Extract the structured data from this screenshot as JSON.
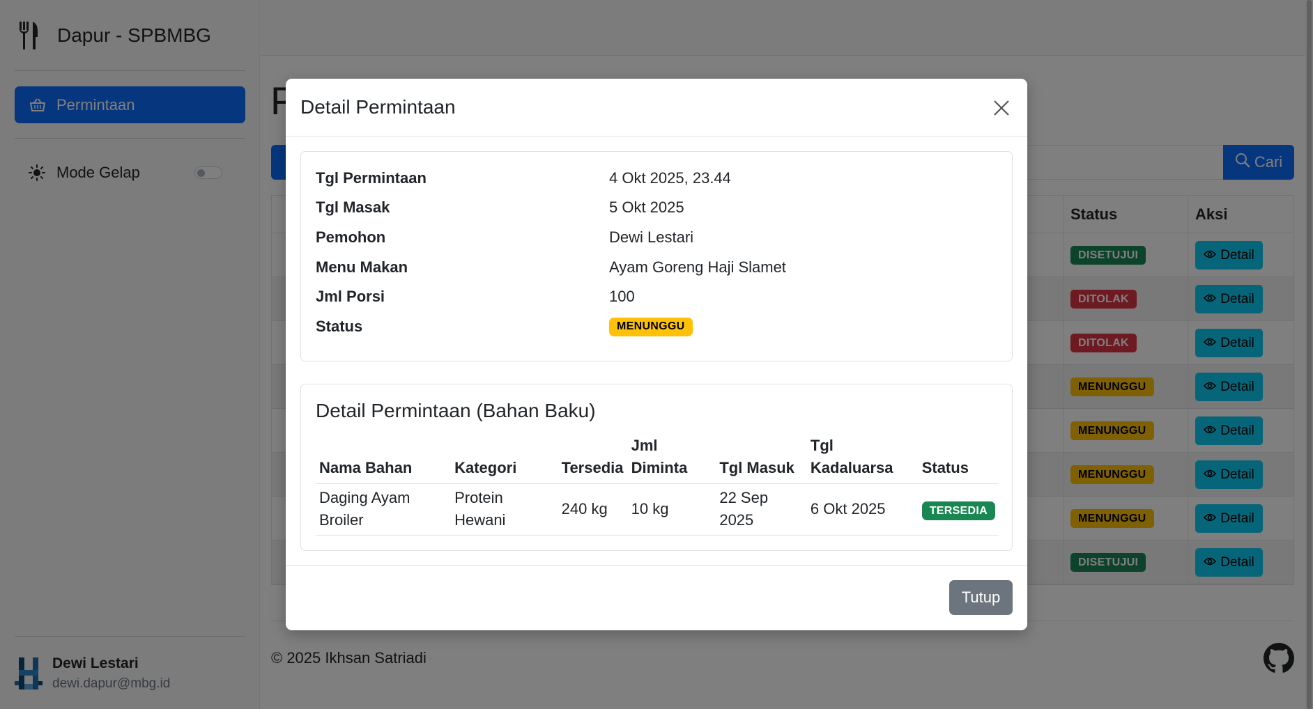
{
  "sidebar": {
    "brand": "Dapur - SPBMBG",
    "nav": [
      {
        "label": "Permintaan",
        "icon": "basket-icon"
      }
    ],
    "dark_mode_label": "Mode Gelap",
    "user": {
      "name": "Dewi Lestari",
      "email": "dewi.dapur@mbg.id"
    }
  },
  "page": {
    "title_peek": "P",
    "search_button": "Cari",
    "table_headers": {
      "status": "Status",
      "aksi": "Aksi"
    },
    "rows": [
      {
        "status": "DISETUJUI",
        "status_color": "#198754",
        "action": "Detail"
      },
      {
        "status": "DITOLAK",
        "status_color": "#dc3545",
        "action": "Detail"
      },
      {
        "status": "DITOLAK",
        "status_color": "#dc3545",
        "action": "Detail"
      },
      {
        "status": "MENUNGGU",
        "status_color": "#ffc107",
        "action": "Detail"
      },
      {
        "status": "MENUNGGU",
        "status_color": "#ffc107",
        "action": "Detail"
      },
      {
        "status": "MENUNGGU",
        "status_color": "#ffc107",
        "action": "Detail"
      },
      {
        "status": "MENUNGGU",
        "status_color": "#ffc107",
        "action": "Detail"
      },
      {
        "status": "DISETUJUI",
        "status_color": "#198754",
        "action": "Detail"
      }
    ],
    "footer": "© 2025 Ikhsan Satriadi"
  },
  "modal": {
    "title": "Detail Permintaan",
    "info": {
      "tgl_permintaan_label": "Tgl Permintaan",
      "tgl_permintaan": "4 Okt 2025, 23.44",
      "tgl_masak_label": "Tgl Masak",
      "tgl_masak": "5 Okt 2025",
      "pemohon_label": "Pemohon",
      "pemohon": "Dewi Lestari",
      "menu_label": "Menu Makan",
      "menu": "Ayam Goreng Haji Slamet",
      "porsi_label": "Jml Porsi",
      "porsi": "100",
      "status_label": "Status",
      "status": "MENUNGGU"
    },
    "bahan": {
      "title": "Detail Permintaan (Bahan Baku)",
      "headers": {
        "nama": "Nama Bahan",
        "kategori": "Kategori",
        "tersedia": "Tersedia",
        "diminta": "Jml Diminta",
        "masuk": "Tgl Masuk",
        "kadaluarsa": "Tgl Kadaluarsa",
        "status": "Status"
      },
      "rows": [
        {
          "nama": "Daging Ayam Broiler",
          "kategori": "Protein Hewani",
          "tersedia": "240 kg",
          "diminta": "10 kg",
          "masuk": "22 Sep 2025",
          "kadaluarsa": "6 Okt 2025",
          "status": "TERSEDIA"
        }
      ]
    },
    "close_button": "Tutup"
  },
  "colors": {
    "primary": "#0d6efd",
    "success": "#198754",
    "danger": "#dc3545",
    "warning": "#ffc107",
    "info": "#0dcaf0",
    "secondary": "#6c757d"
  }
}
